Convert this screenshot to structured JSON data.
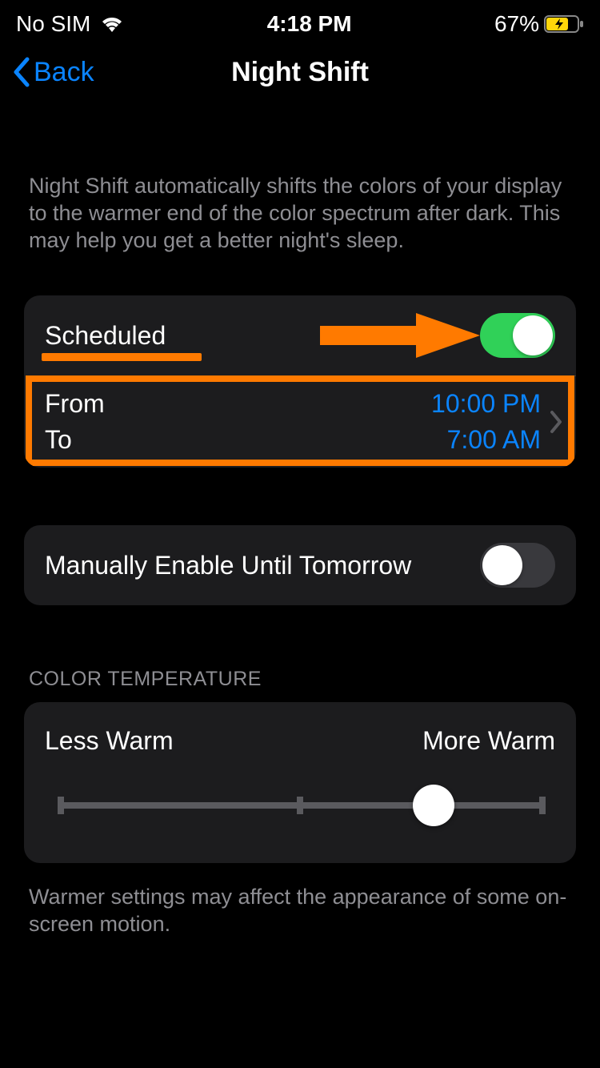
{
  "status": {
    "carrier": "No SIM",
    "time": "4:18 PM",
    "battery_pct": "67%"
  },
  "nav": {
    "back_label": "Back",
    "title": "Night Shift"
  },
  "description": "Night Shift automatically shifts the colors of your display to the warmer end of the color spectrum after dark. This may help you get a better night's sleep.",
  "scheduled": {
    "label": "Scheduled",
    "enabled": true,
    "from_label": "From",
    "to_label": "To",
    "from_time": "10:00 PM",
    "to_time": "7:00 AM"
  },
  "manual": {
    "label": "Manually Enable Until Tomorrow",
    "enabled": false
  },
  "temperature": {
    "section_header": "COLOR TEMPERATURE",
    "less_label": "Less Warm",
    "more_label": "More Warm",
    "value_pct": 78
  },
  "footer": "Warmer settings may affect the appearance of some on-screen motion.",
  "annotations": {
    "arrow_color": "#ff7a00",
    "highlight_color": "#ff7a00"
  }
}
